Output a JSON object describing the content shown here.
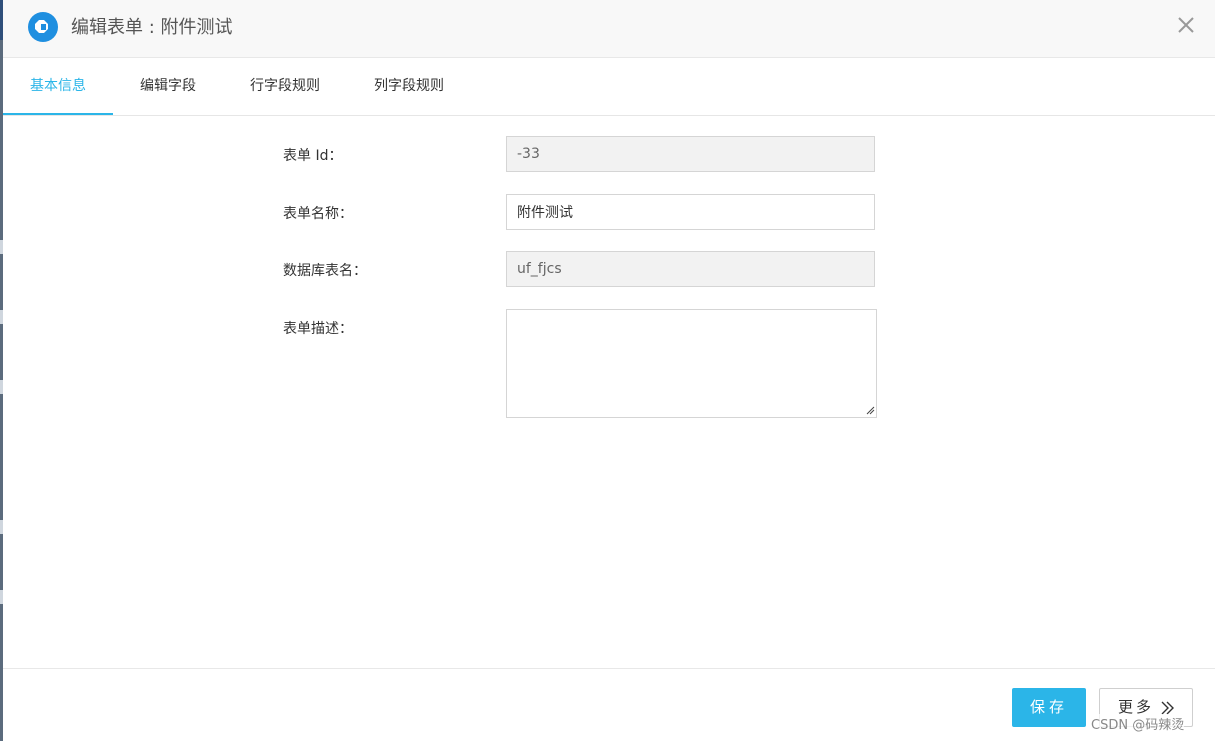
{
  "dialog": {
    "title": "编辑表单 : 附件测试",
    "icons": {
      "logo": "app-logo-icon",
      "close": "close-icon"
    }
  },
  "tabs": [
    {
      "label": "基本信息",
      "active": true
    },
    {
      "label": "编辑字段",
      "active": false
    },
    {
      "label": "行字段规则",
      "active": false
    },
    {
      "label": "列字段规则",
      "active": false
    }
  ],
  "form": {
    "form_id": {
      "label": "表单 Id：",
      "value": "-33",
      "readonly": true
    },
    "form_name": {
      "label": "表单名称：",
      "value": "附件测试",
      "readonly": false
    },
    "table_name": {
      "label": "数据库表名：",
      "value": "uf_fjcs",
      "readonly": true
    },
    "description": {
      "label": "表单描述：",
      "value": ""
    }
  },
  "footer": {
    "save_label": "保存",
    "more_label": "更多"
  },
  "watermark": "CSDN @码辣烫",
  "colors": {
    "accent": "#2bb5e8",
    "logo": "#1f8fe0"
  }
}
